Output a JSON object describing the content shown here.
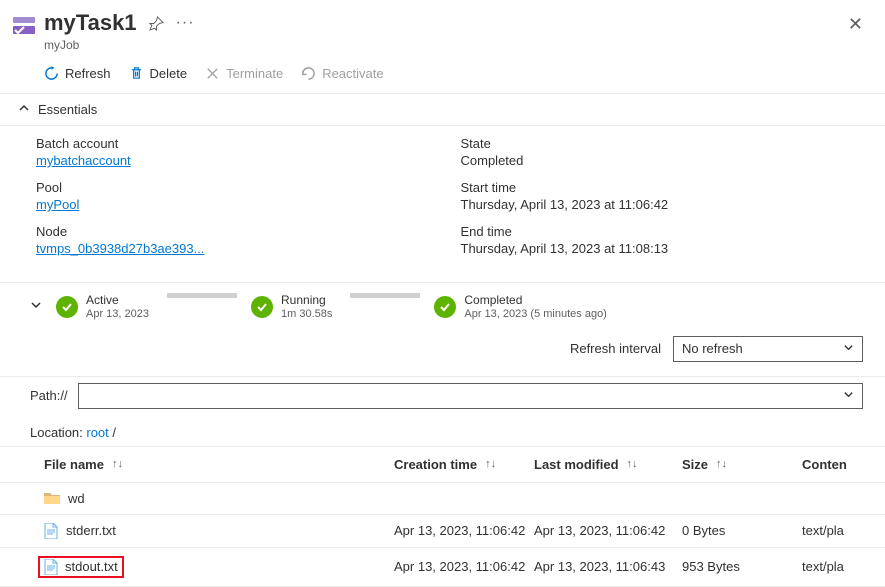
{
  "header": {
    "title": "myTask1",
    "subtitle": "myJob"
  },
  "toolbar": {
    "refresh": "Refresh",
    "delete": "Delete",
    "terminate": "Terminate",
    "reactivate": "Reactivate"
  },
  "essentials": {
    "heading": "Essentials",
    "left": {
      "batch_label": "Batch account",
      "batch_value": "mybatchaccount",
      "pool_label": "Pool",
      "pool_value": "myPool",
      "node_label": "Node",
      "node_value": "tvmps_0b3938d27b3ae393..."
    },
    "right": {
      "state_label": "State",
      "state_value": "Completed",
      "start_label": "Start time",
      "start_value": "Thursday, April 13, 2023 at 11:06:42",
      "end_label": "End time",
      "end_value": "Thursday, April 13, 2023 at 11:08:13"
    }
  },
  "timeline": {
    "active": {
      "title": "Active",
      "sub": "Apr 13, 2023"
    },
    "running": {
      "title": "Running",
      "sub": "1m 30.58s"
    },
    "completed": {
      "title": "Completed",
      "sub": "Apr 13, 2023 (5 minutes ago)"
    }
  },
  "refresh_interval": {
    "label": "Refresh interval",
    "value": "No refresh"
  },
  "path": {
    "label": "Path://"
  },
  "location": {
    "prefix": "Location: ",
    "root": "root",
    "suffix": " /"
  },
  "columns": {
    "name": "File name",
    "ctime": "Creation time",
    "mtime": "Last modified",
    "size": "Size",
    "type": "Conten"
  },
  "rows": [
    {
      "kind": "folder",
      "name": "wd",
      "ctime": "",
      "mtime": "",
      "size": "",
      "type": ""
    },
    {
      "kind": "file",
      "name": "stderr.txt",
      "ctime": "Apr 13, 2023, 11:06:42",
      "mtime": "Apr 13, 2023, 11:06:42",
      "size": "0 Bytes",
      "type": "text/pla"
    },
    {
      "kind": "file",
      "name": "stdout.txt",
      "ctime": "Apr 13, 2023, 11:06:42",
      "mtime": "Apr 13, 2023, 11:06:43",
      "size": "953 Bytes",
      "type": "text/pla",
      "highlight": true
    }
  ]
}
